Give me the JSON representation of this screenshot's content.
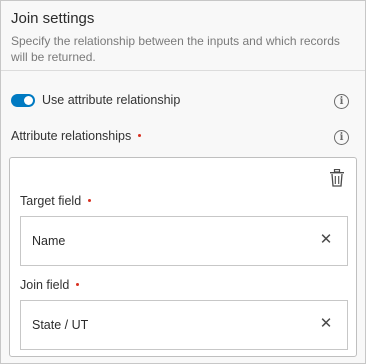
{
  "header": {
    "title": "Join settings",
    "description": "Specify the relationship between the inputs and which records will be returned."
  },
  "toggle": {
    "label": "Use attribute relationship",
    "checked": true,
    "color": "#007ac2"
  },
  "attribute_relationships": {
    "label": "Attribute relationships",
    "required_color": "#d83020"
  },
  "card": {
    "delete_icon": "trash-icon",
    "target_field": {
      "label": "Target field",
      "value": "Name"
    },
    "join_field": {
      "label": "Join field",
      "value": "State / UT"
    }
  },
  "icons": {
    "info": "info-icon",
    "clear": "close-icon",
    "info_glyph": "i",
    "clear_glyph": "✕"
  }
}
